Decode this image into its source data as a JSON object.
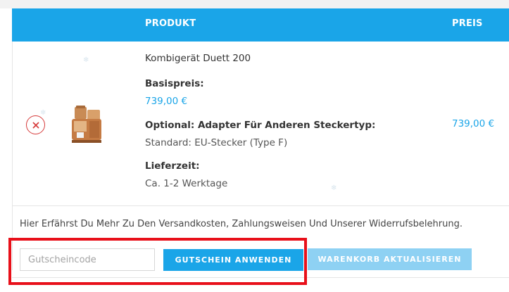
{
  "table": {
    "header_product": "PRODUKT",
    "header_price": "PREIS"
  },
  "item": {
    "name": "Kombigerät Duett 200",
    "base_price_label": "Basispreis:",
    "base_price_value": "739,00 €",
    "option_label": "Optional: Adapter Für Anderen Steckertyp:",
    "option_value": "Standard: EU-Stecker (Type F)",
    "delivery_label": "Lieferzeit:",
    "delivery_value": "Ca. 1-2 Werktage",
    "line_price": "739,00 €",
    "remove_icon": "close-icon",
    "thumbnail_icon": "grain-mill-image"
  },
  "info_text": "Hier Erfährst Du Mehr Zu Den Versandkosten, Zahlungsweisen Und Unserer Widerrufsbelehrung.",
  "coupon": {
    "placeholder": "Gutscheincode",
    "apply_label": "GUTSCHEIN ANWENDEN",
    "update_label": "WARENKORB AKTUALISIEREN"
  },
  "colors": {
    "accent": "#1aa5e8",
    "accent_disabled": "#8ed1f3",
    "remove": "#d63a3a",
    "highlight": "#e8101a"
  }
}
